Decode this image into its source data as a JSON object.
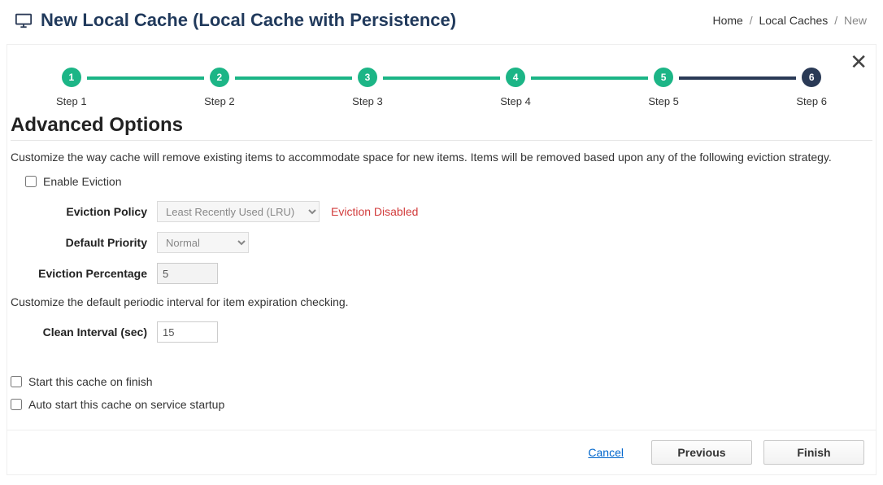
{
  "header": {
    "title": "New Local Cache (Local Cache with Persistence)"
  },
  "breadcrumb": {
    "home": "Home",
    "mid": "Local Caches",
    "current": "New"
  },
  "stepper": {
    "steps": [
      {
        "num": "1",
        "label": "Step 1"
      },
      {
        "num": "2",
        "label": "Step 2"
      },
      {
        "num": "3",
        "label": "Step 3"
      },
      {
        "num": "4",
        "label": "Step 4"
      },
      {
        "num": "5",
        "label": "Step 5"
      },
      {
        "num": "6",
        "label": "Step 6"
      }
    ]
  },
  "section": {
    "title": "Advanced Options",
    "desc1": "Customize the way cache will remove existing items to accommodate space for new items. Items will be removed based upon any of the following eviction strategy.",
    "enable_eviction_label": "Enable Eviction",
    "eviction_policy_label": "Eviction Policy",
    "eviction_policy_value": "Least Recently Used (LRU)",
    "eviction_disabled_msg": "Eviction Disabled",
    "default_priority_label": "Default Priority",
    "default_priority_value": "Normal",
    "eviction_pct_label": "Eviction Percentage",
    "eviction_pct_value": "5",
    "desc2": "Customize the default periodic interval for item expiration checking.",
    "clean_interval_label": "Clean Interval (sec)",
    "clean_interval_value": "15",
    "start_on_finish_label": "Start this cache on finish",
    "auto_start_label": "Auto start this cache on service startup"
  },
  "footer": {
    "cancel": "Cancel",
    "previous": "Previous",
    "finish": "Finish"
  }
}
